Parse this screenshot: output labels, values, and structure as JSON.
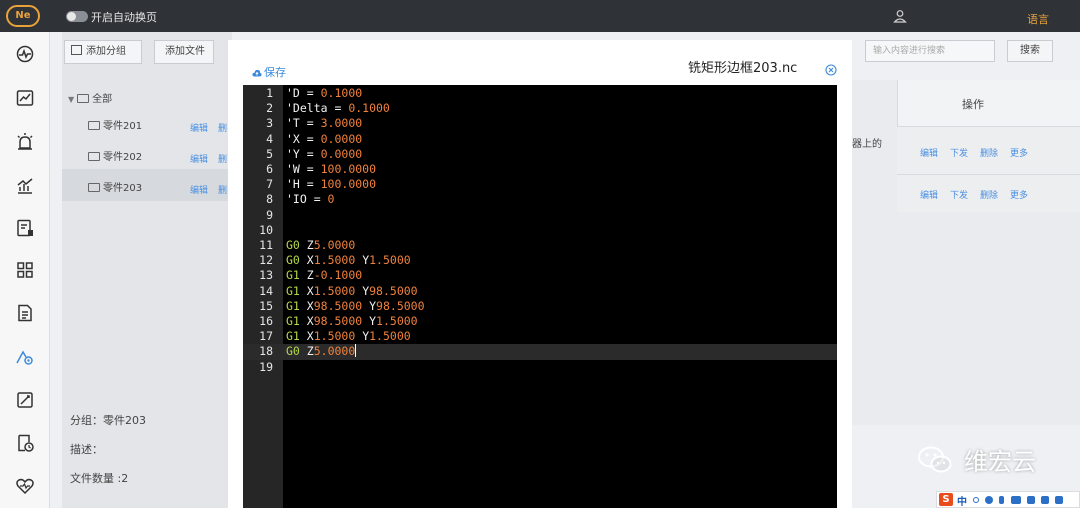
{
  "topbar": {
    "logo_text": "Ne",
    "auto_page_label": "开启自动换页",
    "language_label": "语言"
  },
  "sidebar": {
    "icons": [
      "dashboard-icon",
      "chart-trend-icon",
      "alarm-icon",
      "bar-chart-icon",
      "device-report-icon",
      "grid-icon",
      "document-icon",
      "machine-files-icon",
      "edit-report-icon",
      "schedule-icon",
      "health-icon"
    ],
    "active_index": 7
  },
  "toolbar": {
    "add_group_label": "添加分组",
    "add_file_label": "添加文件",
    "search_placeholder": "输入内容进行搜索",
    "search_button_label": "搜索"
  },
  "tree": {
    "root_label": "全部",
    "items": [
      {
        "label": "零件201",
        "edit": "编辑",
        "del": "删"
      },
      {
        "label": "零件202",
        "edit": "编辑",
        "del": "删"
      },
      {
        "label": "零件203",
        "edit": "编辑",
        "del": "删"
      }
    ]
  },
  "table": {
    "header_ops": "操作",
    "partial_text": "器上的",
    "row_actions": [
      "编辑",
      "下发",
      "删除",
      "更多"
    ]
  },
  "info": {
    "group_line": "分组：零件203",
    "desc_line": "描述：",
    "count_line": "文件数量 :2"
  },
  "modal": {
    "save_label": "保存",
    "file_title": "铣矩形边框203.nc",
    "active_line": 18,
    "lines": [
      {
        "n": "1",
        "tokens": [
          {
            "t": "'D = ",
            "c": "w"
          },
          {
            "t": "0.1000",
            "c": "n"
          }
        ]
      },
      {
        "n": "2",
        "tokens": [
          {
            "t": "'Delta = ",
            "c": "w"
          },
          {
            "t": "0.1000",
            "c": "n"
          }
        ]
      },
      {
        "n": "3",
        "tokens": [
          {
            "t": "'T = ",
            "c": "w"
          },
          {
            "t": "3.0000",
            "c": "n"
          }
        ]
      },
      {
        "n": "4",
        "tokens": [
          {
            "t": "'X = ",
            "c": "w"
          },
          {
            "t": "0.0000",
            "c": "n"
          }
        ]
      },
      {
        "n": "5",
        "tokens": [
          {
            "t": "'Y = ",
            "c": "w"
          },
          {
            "t": "0.0000",
            "c": "n"
          }
        ]
      },
      {
        "n": "6",
        "tokens": [
          {
            "t": "'W = ",
            "c": "w"
          },
          {
            "t": "100.0000",
            "c": "n"
          }
        ]
      },
      {
        "n": "7",
        "tokens": [
          {
            "t": "'H = ",
            "c": "w"
          },
          {
            "t": "100.0000",
            "c": "n"
          }
        ]
      },
      {
        "n": "8",
        "tokens": [
          {
            "t": "'IO = ",
            "c": "w"
          },
          {
            "t": "0",
            "c": "n"
          }
        ]
      },
      {
        "n": "9",
        "tokens": []
      },
      {
        "n": "10",
        "tokens": []
      },
      {
        "n": "11",
        "tokens": [
          {
            "t": "G0",
            "c": "g"
          },
          {
            "t": " Z",
            "c": "w"
          },
          {
            "t": "5.0000",
            "c": "n"
          }
        ]
      },
      {
        "n": "12",
        "tokens": [
          {
            "t": "G0",
            "c": "g"
          },
          {
            "t": " X",
            "c": "w"
          },
          {
            "t": "1.5000",
            "c": "n"
          },
          {
            "t": " Y",
            "c": "w"
          },
          {
            "t": "1.5000",
            "c": "n"
          }
        ]
      },
      {
        "n": "13",
        "tokens": [
          {
            "t": "G1",
            "c": "g"
          },
          {
            "t": " Z",
            "c": "w"
          },
          {
            "t": "-0.1000",
            "c": "n"
          }
        ]
      },
      {
        "n": "14",
        "tokens": [
          {
            "t": "G1",
            "c": "g"
          },
          {
            "t": " X",
            "c": "w"
          },
          {
            "t": "1.5000",
            "c": "n"
          },
          {
            "t": " Y",
            "c": "w"
          },
          {
            "t": "98.5000",
            "c": "n"
          }
        ]
      },
      {
        "n": "15",
        "tokens": [
          {
            "t": "G1",
            "c": "g"
          },
          {
            "t": " X",
            "c": "w"
          },
          {
            "t": "98.5000",
            "c": "n"
          },
          {
            "t": " Y",
            "c": "w"
          },
          {
            "t": "98.5000",
            "c": "n"
          }
        ]
      },
      {
        "n": "16",
        "tokens": [
          {
            "t": "G1",
            "c": "g"
          },
          {
            "t": " X",
            "c": "w"
          },
          {
            "t": "98.5000",
            "c": "n"
          },
          {
            "t": " Y",
            "c": "w"
          },
          {
            "t": "1.5000",
            "c": "n"
          }
        ]
      },
      {
        "n": "17",
        "tokens": [
          {
            "t": "G1",
            "c": "g"
          },
          {
            "t": " X",
            "c": "w"
          },
          {
            "t": "1.5000",
            "c": "n"
          },
          {
            "t": " Y",
            "c": "w"
          },
          {
            "t": "1.5000",
            "c": "n"
          }
        ]
      },
      {
        "n": "18",
        "tokens": [
          {
            "t": "G0",
            "c": "g"
          },
          {
            "t": " Z",
            "c": "w"
          },
          {
            "t": "5.0000",
            "c": "n"
          }
        ]
      },
      {
        "n": "19",
        "tokens": []
      }
    ]
  },
  "watermark": {
    "text": "维宏云"
  },
  "ime": {
    "mode": "中"
  },
  "colors": {
    "topbar": "#2f3338",
    "accent_orange": "#e8a23a",
    "link_blue": "#3b8ad9",
    "code_number": "#f0813c",
    "code_gcode": "#b5d84a",
    "editor_bg": "#000000"
  }
}
